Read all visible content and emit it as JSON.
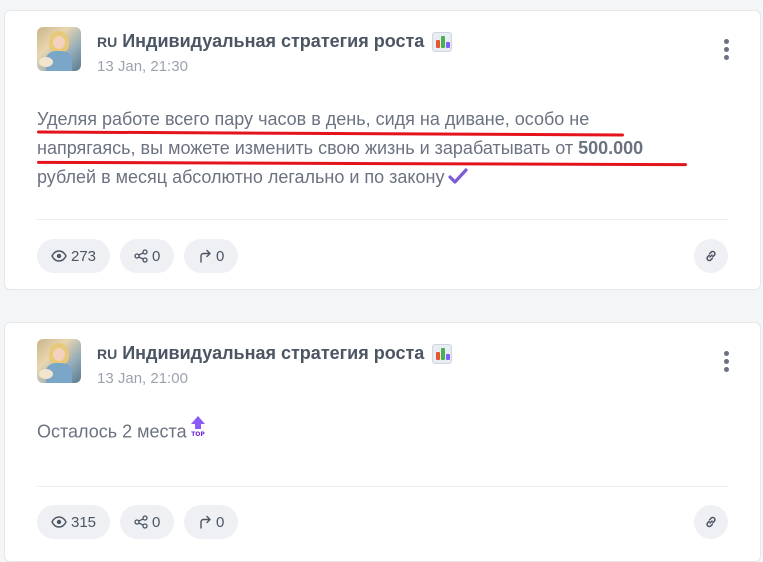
{
  "accent_underline_color": "#e3141b",
  "posts": [
    {
      "channel_prefix": "RU",
      "channel_name": "Индивидуальная стратегия роста",
      "channel_emoji_icon": "bar-chart-icon",
      "date": "13 Jan, 21:30",
      "text_line1": "Уделяя работе всего пару часов в день, сидя на диване, особо не",
      "text_line2_prefix": "напрягаясь, вы можете изменить свою жизнь и зарабатывать от ",
      "text_line2_bold": "500.000",
      "text_line3": "рублей в месяц абсолютно легально и по закону",
      "trailing_icon": "check-mark-icon",
      "views": "273",
      "shares": "0",
      "forwards": "0"
    },
    {
      "channel_prefix": "RU",
      "channel_name": "Индивидуальная стратегия роста",
      "channel_emoji_icon": "bar-chart-icon",
      "date": "13 Jan, 21:00",
      "text_line1": "Осталось 2 места",
      "trailing_icon": "top-arrow-icon",
      "views": "315",
      "shares": "0",
      "forwards": "0"
    }
  ]
}
